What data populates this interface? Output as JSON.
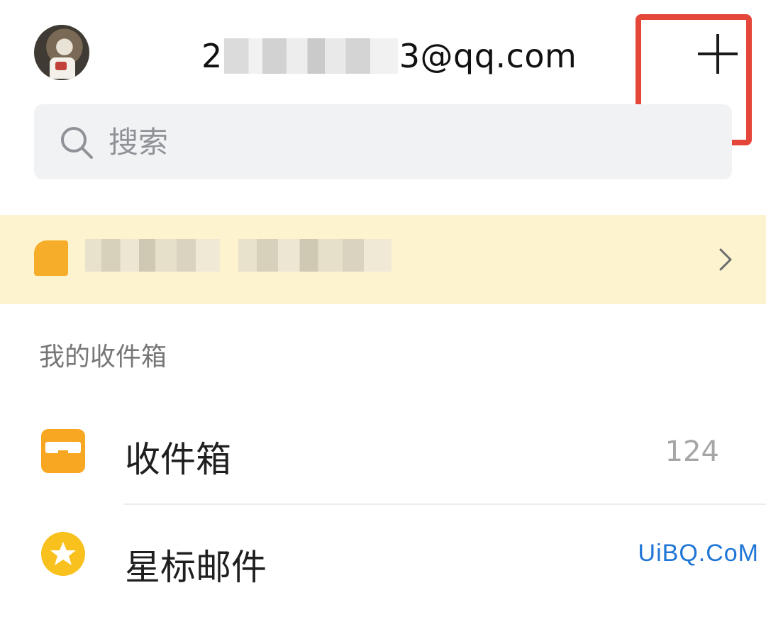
{
  "header": {
    "email_prefix": "2",
    "email_suffix": "3@qq.com",
    "add_label": "+"
  },
  "search": {
    "placeholder": "搜索"
  },
  "banner": {
    "text": ""
  },
  "section": {
    "title": "我的收件箱"
  },
  "rows": [
    {
      "label": "收件箱",
      "count": "124",
      "icon": "inbox-icon"
    },
    {
      "label": "星标邮件",
      "count": "",
      "icon": "star-icon"
    }
  ],
  "watermark": "UiBQ.CoM",
  "colors": {
    "highlight": "#e5463a",
    "inbox_icon": "#f7a722",
    "star_icon": "#f8c11e",
    "banner_bg": "#fdf3cf",
    "watermark": "#1f76d6"
  }
}
